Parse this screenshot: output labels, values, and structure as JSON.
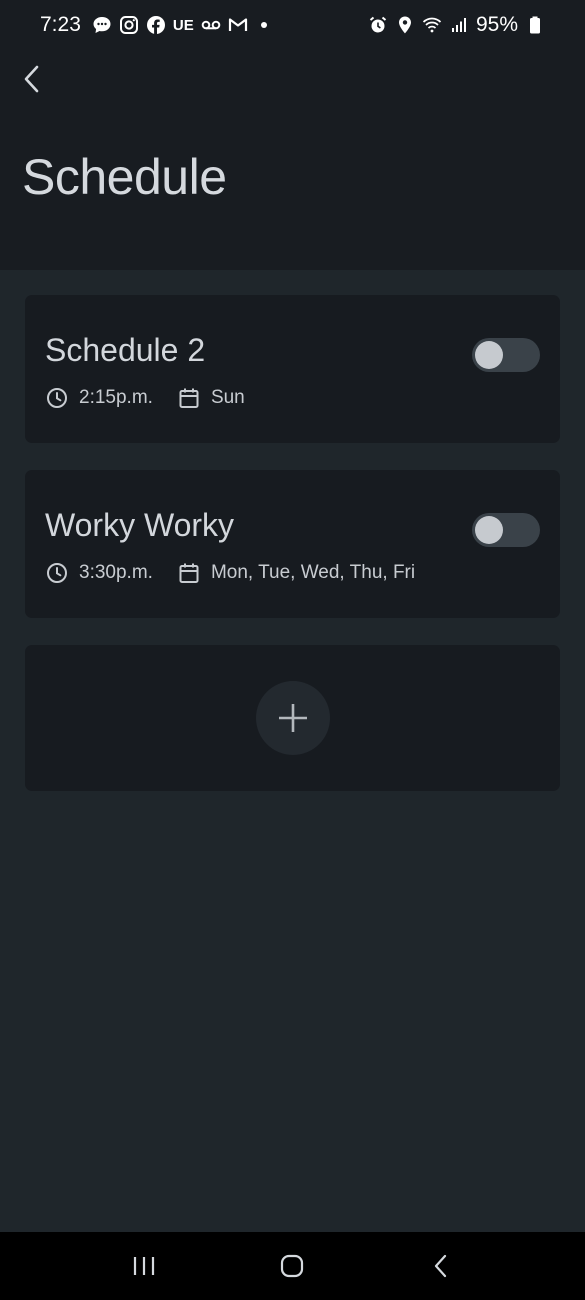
{
  "status_bar": {
    "time": "7:23",
    "notification_text": "UE",
    "battery": "95%",
    "left_icons": [
      "messages-icon",
      "instagram-icon",
      "facebook-icon",
      "ue-icon",
      "voicemail-icon",
      "gmail-icon"
    ],
    "right_icons": [
      "alarm-icon",
      "location-icon",
      "wifi-icon",
      "signal-icon",
      "battery-icon"
    ]
  },
  "header": {
    "title": "Schedule"
  },
  "schedules": [
    {
      "name": "Schedule 2",
      "time": "2:15p.m.",
      "days": "Sun",
      "enabled": false
    },
    {
      "name": "Worky Worky",
      "time": "3:30p.m.",
      "days": "Mon, Tue, Wed, Thu, Fri",
      "enabled": false
    }
  ],
  "colors": {
    "background": "#1f262b",
    "header_bg": "#181c21",
    "card_bg": "#171b20",
    "toggle_off": "#3a4249",
    "nav_bar": "#000000"
  }
}
